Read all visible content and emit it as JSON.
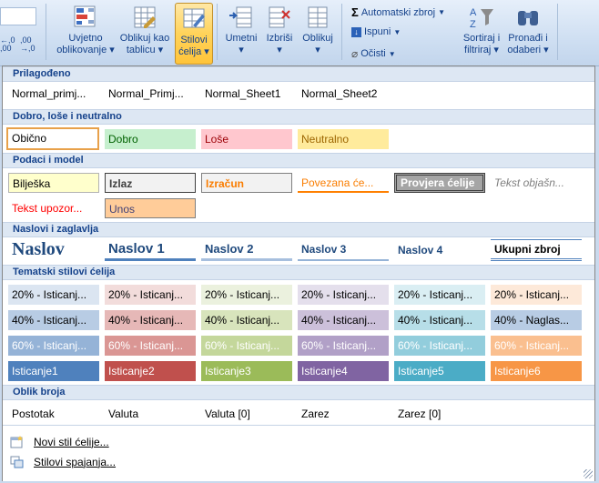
{
  "ribbon": {
    "conditional_formatting": "Uvjetno\noblikovanje",
    "format_as_table": "Oblikuj kao\ntablicu",
    "cell_styles": "Stilovi\nćelija",
    "insert": "Umetni",
    "delete": "Izbriši",
    "format": "Oblikuj",
    "autosum": "Automatski zbroj",
    "fill": "Ispuni",
    "clear": "Očisti",
    "sort_filter": "Sortiraj i\nfiltriraj",
    "find_select": "Pronađi i\nodaberi",
    "left_small_1": "+,0\n,00",
    "left_small_2": ",00\n+,0"
  },
  "gallery": {
    "custom": {
      "title": "Prilagođeno",
      "items": [
        "Normal_primj...",
        "Normal_Primj...",
        "Normal_Sheet1",
        "Normal_Sheet2"
      ]
    },
    "good_bad": {
      "title": "Dobro, loše i neutralno",
      "items": [
        "Obično",
        "Dobro",
        "Loše",
        "Neutralno"
      ]
    },
    "data_model": {
      "title": "Podaci i model",
      "row1": [
        "Bilješka",
        "Izlaz",
        "Izračun",
        "Povezana će...",
        "Provjera ćelije",
        "Tekst objašn..."
      ],
      "row2": [
        "Tekst upozor...",
        "Unos"
      ]
    },
    "titles": {
      "title": "Naslovi i zaglavlja",
      "items": [
        "Naslov",
        "Naslov 1",
        "Naslov 2",
        "Naslov 3",
        "Naslov 4",
        "Ukupni zbroj"
      ]
    },
    "themed": {
      "title": "Tematski stilovi ćelija",
      "row20": [
        "20% - Isticanj...",
        "20% - Isticanj...",
        "20% - Isticanj...",
        "20% - Isticanj...",
        "20% - Isticanj...",
        "20% - Isticanj..."
      ],
      "row40": [
        "40% - Isticanj...",
        "40% - Isticanj...",
        "40% - Isticanj...",
        "40% - Isticanj...",
        "40% - Isticanj...",
        "40% - Naglas..."
      ],
      "row60": [
        "60% - Isticanj...",
        "60% - Isticanj...",
        "60% - Isticanj...",
        "60% - Isticanj...",
        "60% - Isticanj...",
        "60% - Isticanj..."
      ],
      "rowAccent": [
        "Isticanje1",
        "Isticanje2",
        "Isticanje3",
        "Isticanje4",
        "Isticanje5",
        "Isticanje6"
      ]
    },
    "number_format": {
      "title": "Oblik broja",
      "items": [
        "Postotak",
        "Valuta",
        "Valuta [0]",
        "Zarez",
        "Zarez [0]"
      ]
    }
  },
  "menu": {
    "new_style": "Novi stil ćelije...",
    "merge_styles": "Stilovi spajanja..."
  },
  "colors": {
    "accent1": "#4f81bd",
    "accent2": "#c0504d",
    "accent3": "#9bbb59",
    "accent4": "#8064a2",
    "accent5": "#4bacc6",
    "accent6": "#f79646"
  }
}
